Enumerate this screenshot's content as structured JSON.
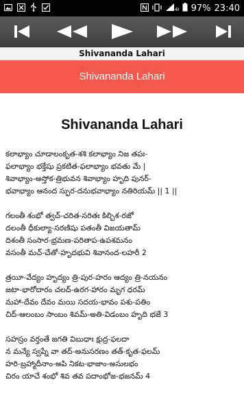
{
  "status_bar": {
    "time": "23:40",
    "battery": "97%",
    "left_icons": [
      "image-icon",
      "close-box-icon",
      "usb-icon",
      "check-box-icon"
    ],
    "right_icons": [
      "nfc-icon",
      "vibrate-icon",
      "signal-icon"
    ]
  },
  "player_controls": [
    {
      "name": "skip-to-start-button",
      "icon": "skip-start-icon"
    },
    {
      "name": "rewind-button",
      "icon": "rewind-icon"
    },
    {
      "name": "play-button",
      "icon": "play-icon"
    },
    {
      "name": "fast-forward-button",
      "icon": "fast-forward-icon"
    },
    {
      "name": "skip-to-end-button",
      "icon": "skip-end-icon"
    }
  ],
  "title_bar": "Shivananda Lahari",
  "banner_title": "Shivananda Lahari",
  "accent_color": "#f5584c",
  "content": {
    "heading": "Shivananda Lahari",
    "stanzas": [
      {
        "lines": [
          "కలాభ్యాం చూడాలంకృత-శశి కలాభ్యాం నిజ తపః-",
          "ఫలాభ్యాం భక్తేషు ప్రకటిత-ఫలాభ్యాం భవతు మే |",
          "శివాభ్యాం-అస్తోక-త్రిభువన శివాభ్యాం హృది పునర్-",
          "భవాభ్యాం ఆనంద స్ఫుర-దనుభవాభ్యాం నతిరియమ్ || 1 ||"
        ]
      },
      {
        "lines": [
          "గలంతీ శంభో త్వచ్-చరిత-సరితః కిల్బిశ-రజో",
          "దలంతీ ధీకుల్యా-సరణిషు పతంతీ విజయతామ్",
          "దిశంతీ సంసార-భ్రమణ-పరితాప-ఉపశమనం",
          "వసంతీ మచ్-చేతో-హృదభువి శివానంద-లహరీ 2"
        ]
      },
      {
        "lines": [
          "త్రయీ-వేద్యం హృద్యం త్రి-పుర-హరం ఆద్యం త్రి-నయనం",
          "జటా-భారోదారం చలద్-ఉరగ-హారం మృగ ధరమ్",
          "మహా-దేవం దేవం మయి సదయ-భావం పశు-పతిం",
          "చిద్-ఆలంబం సాంబం శివమ్-అతి-విడంబం హృది భజే 3"
        ]
      },
      {
        "lines": [
          "సహస్రం వర్తంతే జగతి విబుధాః క్షుద్ర-ఫలదా",
          "న మన్యే స్వప్నే వా తద్-అనుసరణం తత్-కృత-ఫలమ్",
          "హరి-బ్రహ్మాదీనాం-అపి నికట-భాజాం-అసులభం",
          "చిరం యాచే శంభో శివ తవ పదాంభోజ-భజనమ్ 4"
        ]
      }
    ]
  }
}
